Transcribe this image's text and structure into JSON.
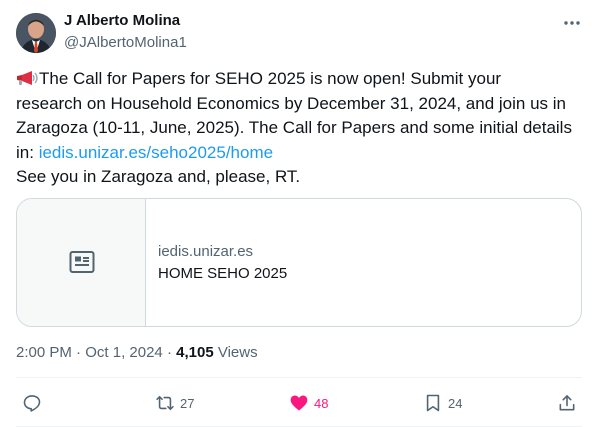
{
  "author": {
    "name": "J Alberto Molina",
    "handle": "@JAlbertoMolina1"
  },
  "icons": {
    "more": "more-horizontal-icon",
    "megaphone": "megaphone-emoji-icon",
    "card": "article-icon",
    "reply": "reply-icon",
    "retweet": "retweet-icon",
    "like": "heart-icon",
    "bookmark": "bookmark-icon",
    "share": "share-icon"
  },
  "tweet": {
    "line1": "The Call for Papers for SEHO 2025 is now open!  Submit your",
    "line2": "research on Household Economics by December 31, 2024, and join us in",
    "line3": "Zaragoza (10-11, June, 2025). The Call for Papers and some initial details",
    "line4_prefix": "in: ",
    "link": "iedis.unizar.es/seho2025/home",
    "line5": "See you in Zaragoza and, please, RT."
  },
  "card": {
    "domain": "iedis.unizar.es",
    "title": "HOME SEHO 2025"
  },
  "meta": {
    "time": "2:00 PM",
    "separator1": " · ",
    "date": "Oct 1, 2024",
    "separator2": " · ",
    "views_count": "4,105",
    "views_label": " Views"
  },
  "actions": {
    "retweets": "27",
    "likes": "48",
    "bookmarks": "24"
  },
  "colors": {
    "link": "#1d9bf0",
    "like": "#f91880",
    "secondary_text": "#536471",
    "border": "#cfd9de"
  }
}
